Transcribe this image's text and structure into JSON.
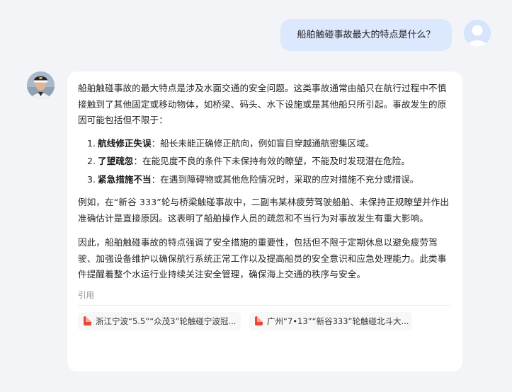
{
  "user_message": {
    "text": "船舶触碰事故最大的特点是什么？"
  },
  "answer": {
    "intro": "船舶触碰事故的最大特点是涉及水面交通的安全问题。这类事故通常由船只在航行过程中不慎接触到了其他固定或移动物体，如桥梁、码头、水下设施或是其他船只所引起。事故发生的原因可能包括但不限于：",
    "list": [
      {
        "num": "1.",
        "title": "航线修正失误",
        "text": "：船长未能正确修正航向，例如盲目穿越通航密集区域。"
      },
      {
        "num": "2.",
        "title": "了望疏忽",
        "text": "：在能见度不良的条件下未保持有效的瞭望，不能及时发现潜在危险。"
      },
      {
        "num": "3.",
        "title": "紧急措施不当",
        "text": "：在遇到障碍物或其他危险情况时，采取的应对措施不充分或措误。"
      }
    ],
    "example": "例如，在“新谷 333”轮与桥梁触碰事故中，二副韦某林疲劳驾驶船舶、未保持正规瞭望并作出准确估计是直接原因。这表明了船舶操作人员的疏忽和不当行为对事故发生有重大影响。",
    "conclusion": "因此，船舶触碰事故的特点强调了安全措施的重要性，包括但不限于定期休息以避免疲劳驾驶、加强设备维护以确保航行系统正常工作以及提高船员的安全意识和应急处理能力。此类事件提醒着整个水运行业持续关注安全管理，确保海上交通的秩序与安全。"
  },
  "references": {
    "label": "引用",
    "items": [
      {
        "icon": "pdf-icon",
        "title": "浙江宁波“5.5”“众茂3”轮触碰宁波冠..."
      },
      {
        "icon": "pdf-icon",
        "title": "广州“7•13”“新谷333”轮触碰北斗大..."
      }
    ]
  }
}
